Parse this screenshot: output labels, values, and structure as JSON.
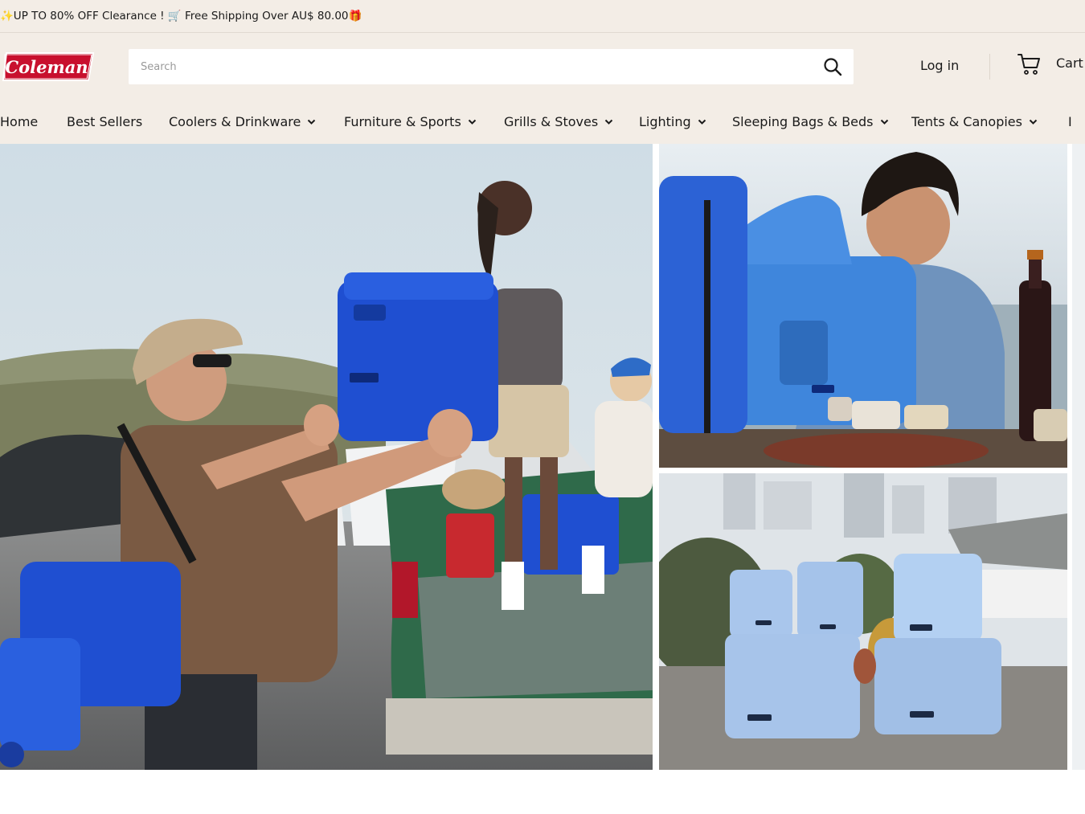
{
  "announcement": {
    "text": "✨UP TO 80% OFF Clearance ! 🛒 Free Shipping Over AU$ 80.00🎁"
  },
  "brand": {
    "logo_text": "Coleman",
    "accent": "#c8102e"
  },
  "search": {
    "placeholder": "Search",
    "value": "",
    "icon": "search-icon"
  },
  "header": {
    "login_label": "Log in",
    "cart_label": "Cart",
    "cart_icon": "cart-icon"
  },
  "nav": {
    "items": [
      {
        "label": "Home",
        "has_dropdown": false
      },
      {
        "label": "Best Sellers",
        "has_dropdown": false
      },
      {
        "label": "Coolers & Drinkware",
        "has_dropdown": true
      },
      {
        "label": "Furniture & Sports",
        "has_dropdown": true
      },
      {
        "label": "Grills & Stoves",
        "has_dropdown": true
      },
      {
        "label": "Lighting",
        "has_dropdown": true
      },
      {
        "label": "Sleeping Bags & Beds",
        "has_dropdown": true
      },
      {
        "label": "Tents & Canopies",
        "has_dropdown": true
      },
      {
        "label": "I",
        "has_dropdown": false
      }
    ]
  },
  "colors": {
    "header_bg": "#f3ede6",
    "cooler_blue": "#1f4fd1",
    "light_blue": "#a9c6ec"
  }
}
